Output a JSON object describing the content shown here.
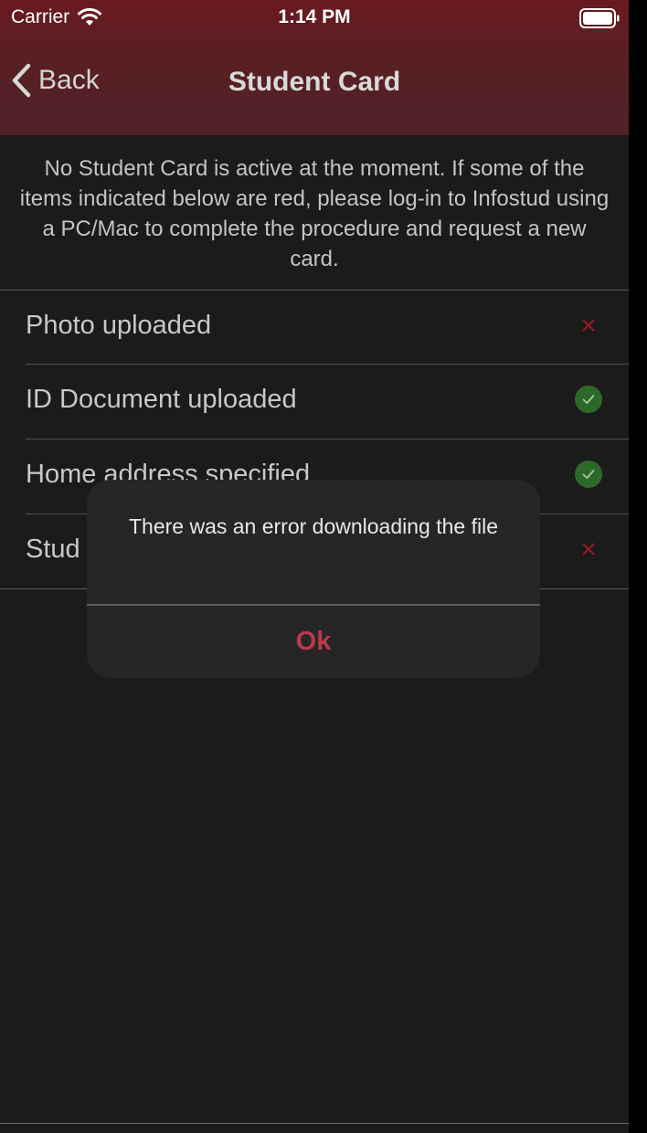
{
  "status_bar": {
    "carrier": "Carrier",
    "time": "1:14 PM"
  },
  "nav": {
    "back_label": "Back",
    "title": "Student Card"
  },
  "intro_text": "No Student Card is active at the moment. If some of the items indicated below are red, please log-in to Infostud using a PC/Mac to complete the procedure and request a new card.",
  "checklist": [
    {
      "label": "Photo uploaded",
      "status": "missing",
      "icon": "x-mark-icon"
    },
    {
      "label": "ID Document uploaded",
      "status": "done",
      "icon": "checkmark-circle-icon"
    },
    {
      "label": "Home address specified",
      "status": "done",
      "icon": "checkmark-circle-icon"
    },
    {
      "label": "Stud",
      "status": "missing",
      "icon": "x-mark-icon"
    }
  ],
  "alert": {
    "message": "There was an error downloading the file",
    "ok_label": "Ok"
  },
  "colors": {
    "nav_background": "#5a1f24",
    "background": "#1b1b1b",
    "error_red": "#a31c24",
    "success_green": "#2d6a2a",
    "alert_button": "#b93a4a"
  }
}
